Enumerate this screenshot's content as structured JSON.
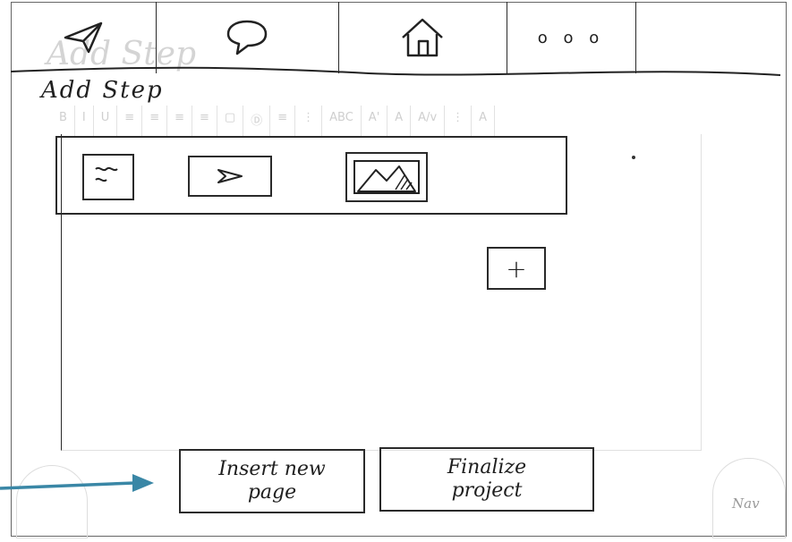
{
  "header": {
    "tabs": [
      {
        "icon": "send-icon"
      },
      {
        "icon": "chat-bubble-icon"
      },
      {
        "icon": "home-icon"
      },
      {
        "icon": "more-icon",
        "label": "o o o"
      },
      {
        "icon": "empty"
      }
    ],
    "ghost_title": "Add Step"
  },
  "page": {
    "title": "Add Step",
    "toolbar_ghost": [
      "B",
      "I",
      "U",
      "≡",
      "≡",
      "≡",
      "≡",
      "▢",
      "Ⓓ",
      "≡",
      "⋮",
      "ABC",
      "A'",
      "A",
      "A/v",
      "⋮",
      "A"
    ]
  },
  "insert_panel": {
    "items": [
      {
        "icon": "text-note-icon"
      },
      {
        "icon": "send-icon"
      },
      {
        "icon": "image-icon"
      }
    ]
  },
  "add_button": {
    "label": "+"
  },
  "footer": {
    "insert_button": "Insert new\npage",
    "finalize_button": "Finalize\nproject",
    "nav_label": "Nav"
  }
}
